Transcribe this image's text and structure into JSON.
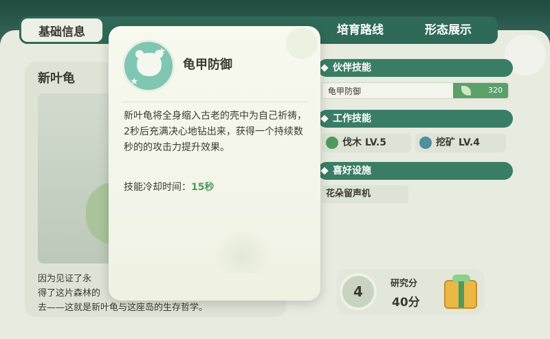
{
  "tabs": [
    {
      "label": "基础信息",
      "active": true
    },
    {
      "label": "培育路线",
      "active": false
    },
    {
      "label": "形态展示",
      "active": false
    }
  ],
  "pet": {
    "name": "新叶龟",
    "description_lines": [
      "因为见证了永",
      "得了这片森林的",
      "去——这就是新叶龟与这座岛的生存哲学。"
    ]
  },
  "sections": {
    "partner_skill": {
      "title": "伙伴技能",
      "skill_name": "龟甲防御",
      "skill_value": "320"
    },
    "work_skill": {
      "title": "工作技能",
      "items": [
        {
          "label": "伐木 LV.5",
          "icon": "axe-icon"
        },
        {
          "label": "挖矿 LV.4",
          "icon": "pickaxe-icon"
        }
      ]
    },
    "favorite_facility": {
      "title": "喜好设施",
      "item": "花朵留声机"
    }
  },
  "research": {
    "level": "4",
    "label": "研究分",
    "value": "40分"
  },
  "popup": {
    "title": "龟甲防御",
    "description": "新叶龟将全身缩入古老的壳中为自己祈祷，2秒后充满决心地钻出来，获得一个持续数秒的的攻击力提升效果。",
    "cooldown_label": "技能冷却时间：",
    "cooldown_value": "15秒"
  },
  "colors": {
    "accent_green": "#3a7d66",
    "tab_bg": "#2f6a58",
    "value_green": "#4f9a5c"
  }
}
